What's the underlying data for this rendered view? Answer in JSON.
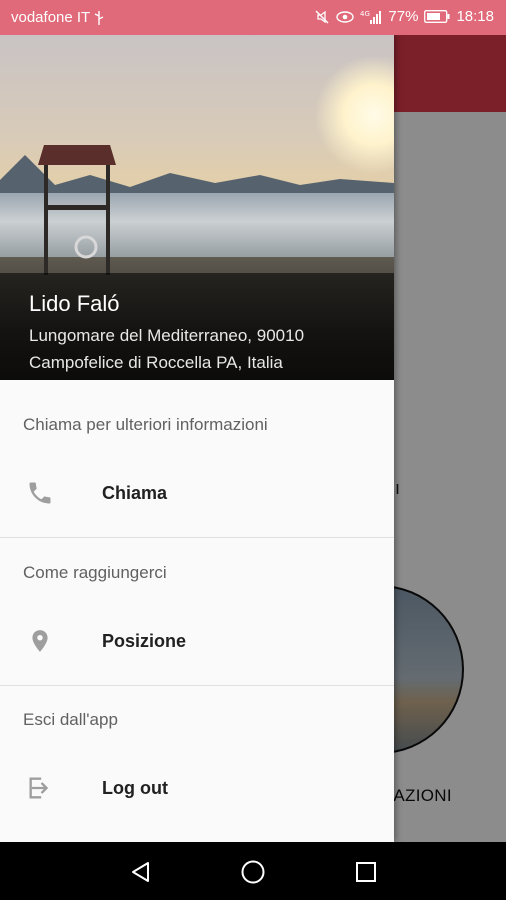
{
  "status_bar": {
    "carrier": "vodafone IT",
    "battery": "77%",
    "time": "18:18",
    "background": "#e06a79"
  },
  "background_app": {
    "toolbar_color": "#e0394c",
    "caption": "TAZIONI"
  },
  "drawer": {
    "header": {
      "name": "Lido Faló",
      "address": "Lungomare del Mediterraneo, 90010 Campofelice di Roccella PA, Italia"
    },
    "sections": [
      {
        "title": "Chiama per ulteriori informazioni",
        "item": {
          "icon": "phone-icon",
          "label": "Chiama"
        }
      },
      {
        "title": "Come raggiungerci",
        "item": {
          "icon": "location-pin-icon",
          "label": "Posizione"
        }
      },
      {
        "title": "Esci dall'app",
        "item": {
          "icon": "logout-icon",
          "label": "Log out"
        }
      }
    ]
  },
  "nav_bar": {
    "buttons": [
      "back-icon",
      "home-icon",
      "recents-icon"
    ]
  }
}
